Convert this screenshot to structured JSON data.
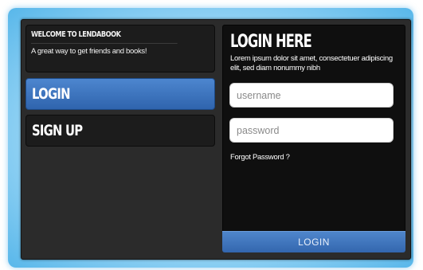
{
  "welcome": {
    "title": "WELCOME TO LENDABOOK",
    "tagline": "A great way to get friends and books!"
  },
  "nav": {
    "login_label": "LOGIN",
    "signup_label": "SIGN UP"
  },
  "login_form": {
    "heading": "LOGIN HERE",
    "description": "Lorem ipsum dolor sit amet, consectetuer adipiscing elit, sed diam nonummy nibh",
    "username_placeholder": "username",
    "password_placeholder": "password",
    "forgot_label": "Forgot Password ?",
    "submit_label": "LOGIN"
  },
  "colors": {
    "accent_blue": "#3a6fb8",
    "panel_dark": "#2b2b2b",
    "glow_blue": "#58b7ea"
  }
}
